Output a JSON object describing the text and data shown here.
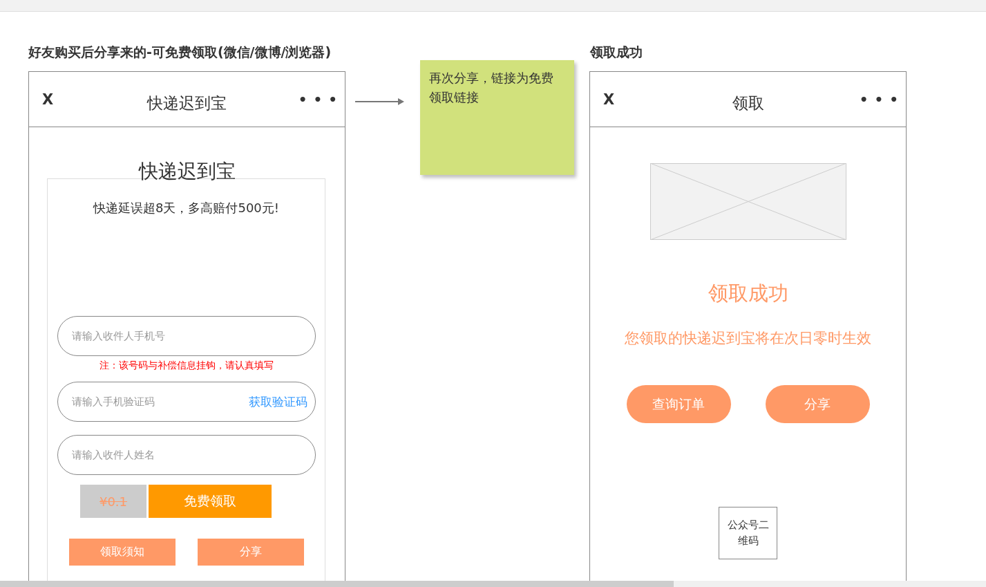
{
  "left_section": {
    "heading": "好友购买后分享来的-可免费领取(微信/微博/浏览器)",
    "phone": {
      "close": "X",
      "title": "快递迟到宝",
      "more": "• • •",
      "banner_title": "快递迟到宝",
      "banner_subtitle": "快递延误超8天，多高赔付500元!",
      "fields": [
        {
          "placeholder": "请输入收件人手机号"
        },
        {
          "placeholder": "请输入手机验证码",
          "action": "获取验证码"
        },
        {
          "placeholder": "请输入收件人姓名"
        }
      ],
      "note": "注：该号码与补偿信息挂钩，请认真填写",
      "old_price": "¥0.1",
      "claim_button": "免费领取",
      "bottom_buttons": [
        "领取须知",
        "分享"
      ]
    }
  },
  "sticky_note": {
    "text": "再次分享，链接为免费领取链接"
  },
  "right_section": {
    "heading": "领取成功",
    "phone": {
      "close": "X",
      "title": "领取",
      "more": "• • •",
      "status_title": "领取成功",
      "status_message": "您领取的快递迟到宝将在次日零时生效",
      "buttons": [
        "查询订单",
        "分享"
      ],
      "qr_placeholder": "公众号二维码"
    }
  }
}
